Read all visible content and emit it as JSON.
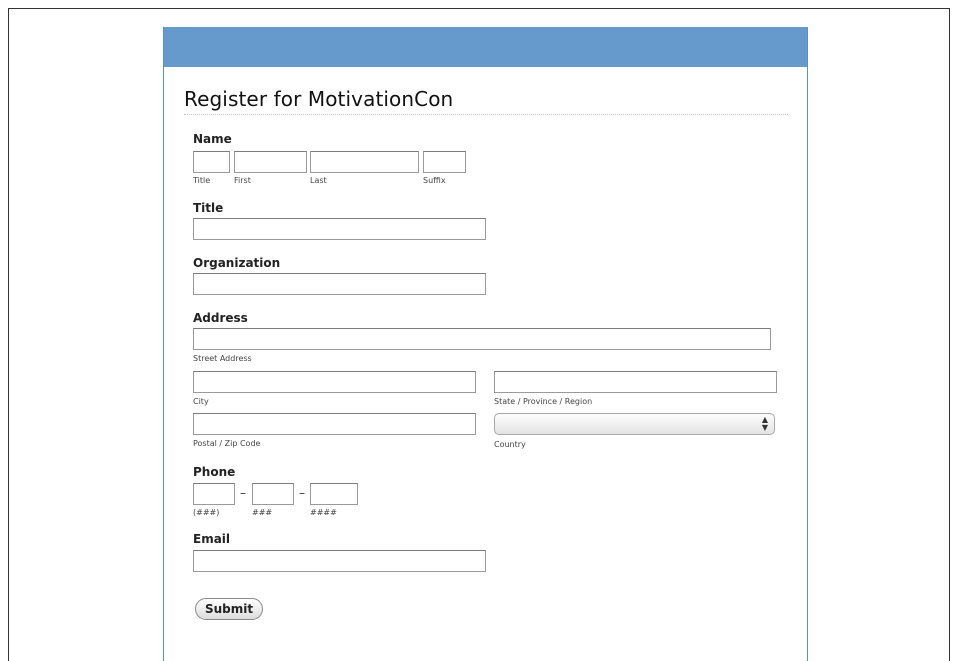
{
  "form": {
    "title": "Register for MotivationCon",
    "name": {
      "label": "Name",
      "sub_title": "Title",
      "sub_first": "First",
      "sub_last": "Last",
      "sub_suffix": "Suffix"
    },
    "job_title": {
      "label": "Title"
    },
    "organization": {
      "label": "Organization"
    },
    "address": {
      "label": "Address",
      "street_sub": "Street Address",
      "city_sub": "City",
      "state_sub": "State / Province / Region",
      "postal_sub": "Postal / Zip Code",
      "country_sub": "Country",
      "country_value": ""
    },
    "phone": {
      "label": "Phone",
      "dash": "–",
      "sub_area": "(###)",
      "sub_prefix": "###",
      "sub_line": "####"
    },
    "email": {
      "label": "Email"
    },
    "submit_label": "Submit"
  },
  "colors": {
    "header_bar": "#6699cc",
    "card_border": "#5b8fc4"
  },
  "icons": {
    "country_select": "up-down-arrows-icon"
  }
}
